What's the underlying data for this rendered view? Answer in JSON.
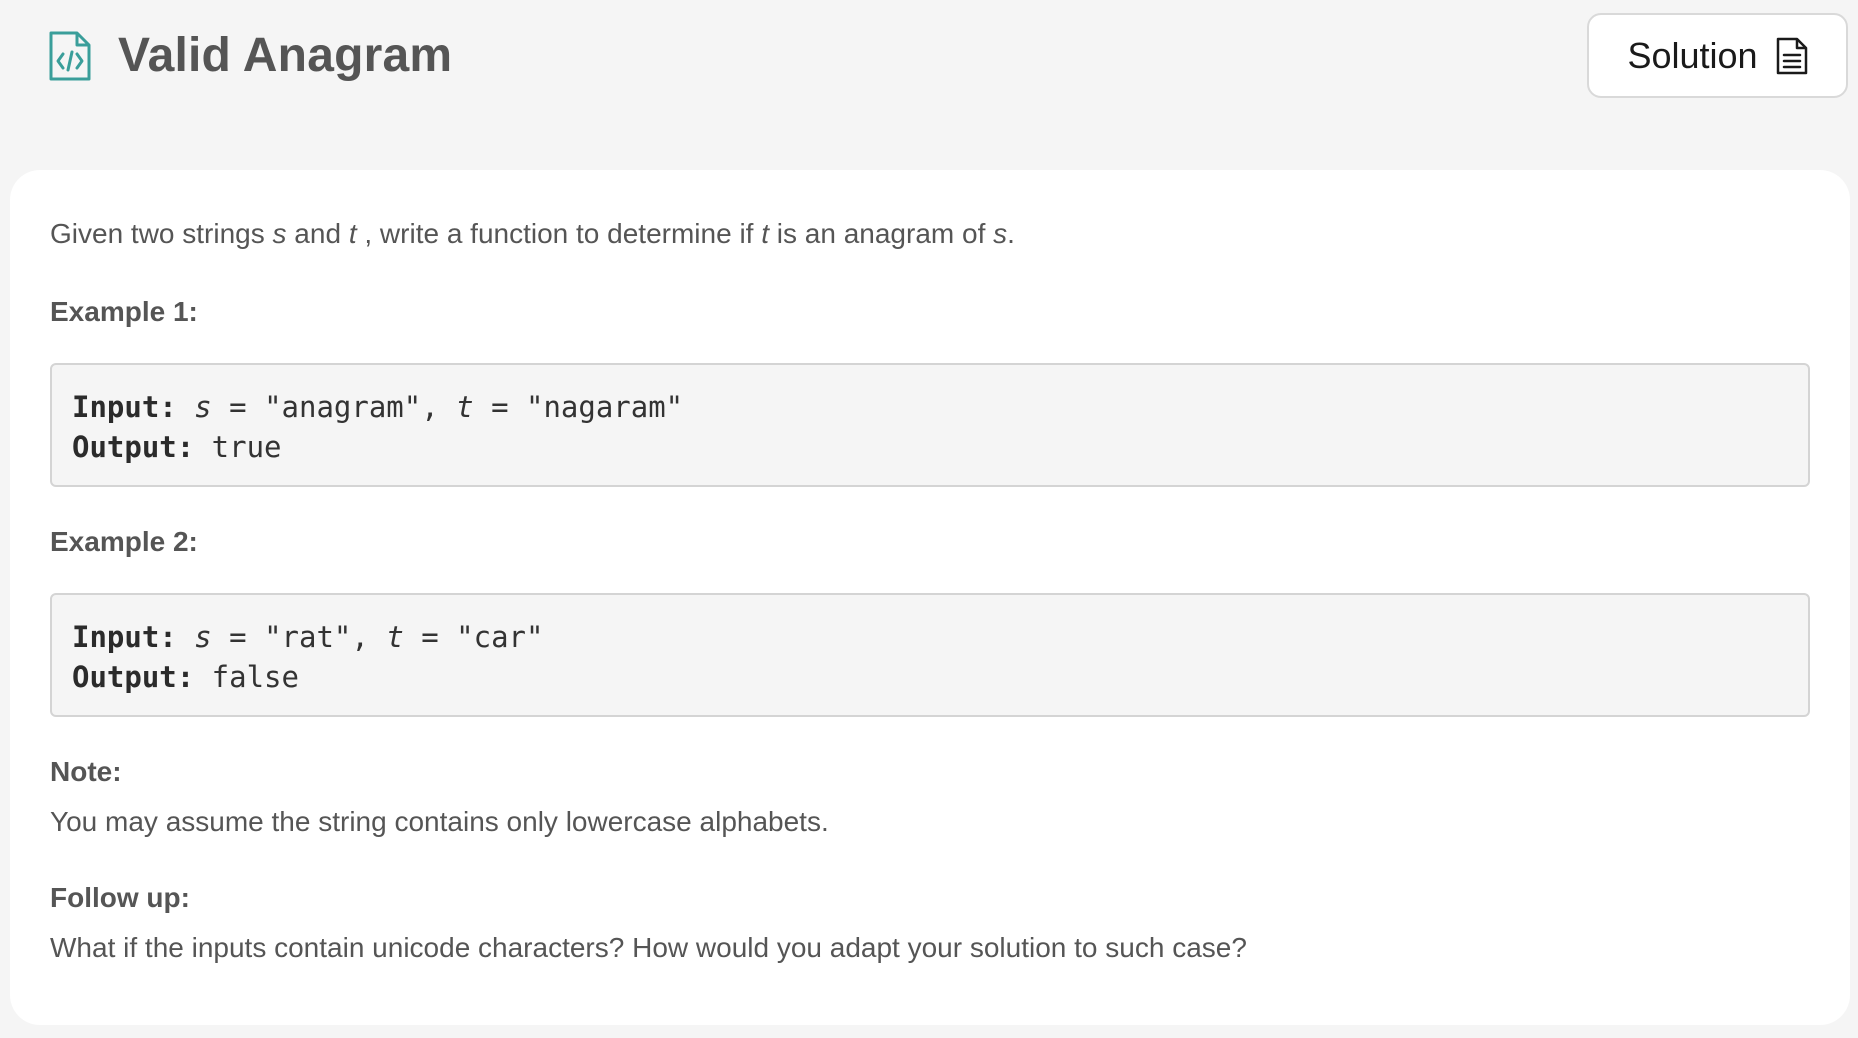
{
  "header": {
    "title": "Valid Anagram",
    "icon": "code-file-icon",
    "solution_label": "Solution",
    "solution_icon": "document-icon",
    "accent_color": "#3a9e9a"
  },
  "problem": {
    "description": {
      "p1": "Given two strings ",
      "var_s": "s",
      "p2": " and ",
      "var_t": "t",
      "p3": " , write a function to determine if ",
      "var_t2": "t",
      "p4": " is an anagram of ",
      "var_s2": "s",
      "p5": "."
    },
    "examples": [
      {
        "heading": "Example 1:",
        "input_label": "Input:",
        "var_s": "s",
        "s_value": " = \"anagram\", ",
        "var_t": "t",
        "t_value": " = \"nagaram\"",
        "output_label": "Output:",
        "output_value": " true"
      },
      {
        "heading": "Example 2:",
        "input_label": "Input:",
        "var_s": "s",
        "s_value": " = \"rat\", ",
        "var_t": "t",
        "t_value": " = \"car\"",
        "output_label": "Output:",
        "output_value": " false"
      }
    ],
    "note": {
      "heading": "Note:",
      "text": "You may assume the string contains only lowercase alphabets."
    },
    "follow_up": {
      "heading": "Follow up:",
      "text": "What if the inputs contain unicode characters? How would you adapt your solution to such case?"
    }
  }
}
